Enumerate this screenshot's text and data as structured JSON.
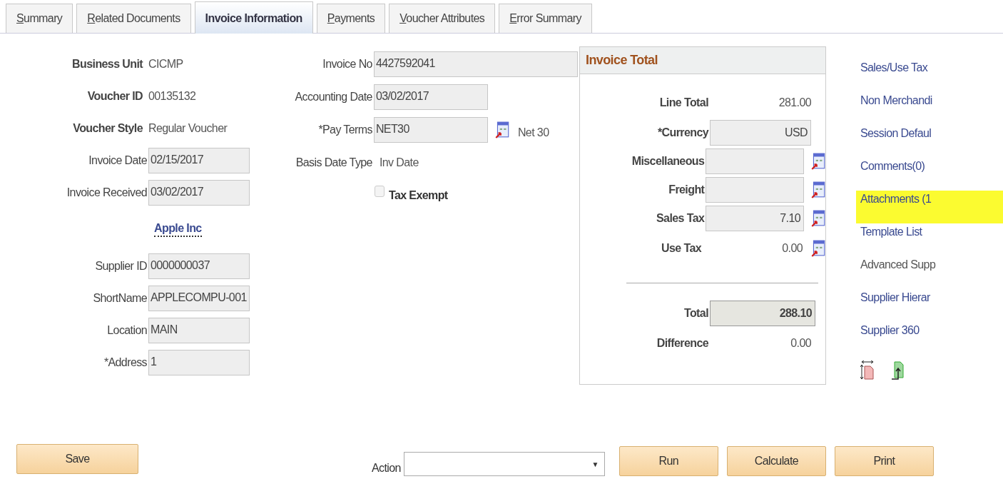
{
  "tabs": [
    {
      "label": "Summary",
      "selected": false,
      "underline_first": true
    },
    {
      "label": "Related Documents",
      "selected": false,
      "underline_first": true
    },
    {
      "label": "Invoice Information",
      "selected": true,
      "underline_first": false
    },
    {
      "label": "Payments",
      "selected": false,
      "underline_first": true
    },
    {
      "label": "Voucher Attributes",
      "selected": false,
      "underline_first": true
    },
    {
      "label": "Error Summary",
      "selected": false,
      "underline_first": true
    }
  ],
  "header_fields": [
    {
      "kind": "text",
      "label": "Business Unit",
      "value": "CICMP"
    },
    {
      "kind": "text",
      "label": "Voucher ID",
      "value": "00135132"
    },
    {
      "kind": "text",
      "label": "Voucher Style",
      "value": "Regular Voucher"
    },
    {
      "kind": "field",
      "label": "Invoice Date",
      "value": "02/15/2017"
    },
    {
      "kind": "field",
      "label": "Invoice Received",
      "value": "03/02/2017"
    },
    {
      "kind": "link",
      "value": "Apple Inc"
    },
    {
      "kind": "field",
      "label": "Supplier ID",
      "value": "0000000037"
    },
    {
      "kind": "field",
      "label": "ShortName",
      "value": "APPLECOMPU-001"
    },
    {
      "kind": "field",
      "label": "Location",
      "value": "MAIN"
    },
    {
      "kind": "field",
      "label": "*Address",
      "value": "1"
    }
  ],
  "invoice_fields": [
    {
      "kind": "field",
      "label": "Invoice No",
      "value": "4427592041",
      "wide": true,
      "lookup": false
    },
    {
      "kind": "field",
      "label": "Accounting Date",
      "value": "03/02/2017",
      "wide": false,
      "lookup": false
    },
    {
      "kind": "field",
      "label": "*Pay Terms",
      "value": "NET30",
      "wide": false,
      "lookup": true,
      "description": "Net 30"
    },
    {
      "kind": "text",
      "label": "Basis Date Type",
      "value": "Inv Date"
    },
    {
      "kind": "checkbox",
      "label": "Tax Exempt",
      "checked": false
    }
  ],
  "invoice_total": {
    "title": "Invoice Total",
    "rows": [
      {
        "kind": "text",
        "label": "Line Total",
        "value": "281.00",
        "lookup": false
      },
      {
        "kind": "field",
        "label": "*Currency",
        "value": "USD",
        "lookup": false
      },
      {
        "kind": "field",
        "label": "Miscellaneous",
        "lookup": true
      },
      {
        "kind": "field",
        "label": "Freight",
        "lookup": true
      },
      {
        "kind": "field",
        "label": "Sales Tax",
        "value": "7.10",
        "lookup": true
      },
      {
        "kind": "text",
        "label": "Use Tax",
        "value": "0.00",
        "lookup": true
      },
      {
        "kind": "total",
        "label": "Total",
        "value": "288.10",
        "lookup": false
      },
      {
        "kind": "text",
        "label": "Difference",
        "value": "0.00",
        "lookup": false
      }
    ]
  },
  "links": [
    {
      "label": "Sales/Use Tax",
      "highlighted": false,
      "disabled": false
    },
    {
      "label": "Non Merchandi",
      "highlighted": false,
      "disabled": false
    },
    {
      "label": "Session Defaul",
      "highlighted": false,
      "disabled": false
    },
    {
      "label": "Comments(0)",
      "highlighted": false,
      "disabled": false
    },
    {
      "label": "Attachments (1",
      "highlighted": true,
      "disabled": false
    },
    {
      "label": "Template List",
      "highlighted": false,
      "disabled": false
    },
    {
      "label": "Advanced Supp",
      "highlighted": false,
      "disabled": true
    },
    {
      "label": "Supplier Hierar",
      "highlighted": false,
      "disabled": false
    },
    {
      "label": "Supplier 360",
      "highlighted": false,
      "disabled": false
    }
  ],
  "save_button": "Save",
  "action": {
    "label": "Action",
    "arrow": "▼"
  },
  "action_buttons": [
    "Run",
    "Calculate",
    "Print"
  ]
}
